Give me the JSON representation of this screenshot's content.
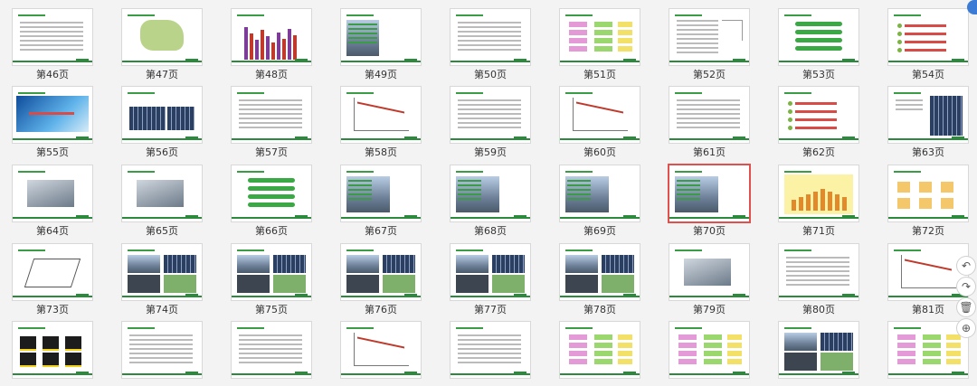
{
  "pages": [
    {
      "label": "第46页",
      "kind": "text",
      "selected": false
    },
    {
      "label": "第47页",
      "kind": "map",
      "selected": false
    },
    {
      "label": "第48页",
      "kind": "bars",
      "selected": false
    },
    {
      "label": "第49页",
      "kind": "photo-left",
      "selected": false
    },
    {
      "label": "第50页",
      "kind": "text",
      "selected": false
    },
    {
      "label": "第51页",
      "kind": "flow",
      "selected": false
    },
    {
      "label": "第52页",
      "kind": "table",
      "selected": false
    },
    {
      "label": "第53页",
      "kind": "diagram",
      "selected": false
    },
    {
      "label": "第54页",
      "kind": "list",
      "selected": false
    },
    {
      "label": "第55页",
      "kind": "banner",
      "selected": false
    },
    {
      "label": "第56页",
      "kind": "panel",
      "selected": false
    },
    {
      "label": "第57页",
      "kind": "text",
      "selected": false
    },
    {
      "label": "第58页",
      "kind": "chart",
      "selected": false
    },
    {
      "label": "第59页",
      "kind": "text",
      "selected": false
    },
    {
      "label": "第60页",
      "kind": "chart",
      "selected": false
    },
    {
      "label": "第61页",
      "kind": "text",
      "selected": false
    },
    {
      "label": "第62页",
      "kind": "list",
      "selected": false
    },
    {
      "label": "第63页",
      "kind": "panel-right",
      "selected": false
    },
    {
      "label": "第64页",
      "kind": "device",
      "selected": false
    },
    {
      "label": "第65页",
      "kind": "device",
      "selected": false
    },
    {
      "label": "第66页",
      "kind": "diagram",
      "selected": false
    },
    {
      "label": "第67页",
      "kind": "photo",
      "selected": false
    },
    {
      "label": "第68页",
      "kind": "photo",
      "selected": false
    },
    {
      "label": "第69页",
      "kind": "photo",
      "selected": false
    },
    {
      "label": "第70页",
      "kind": "photo",
      "selected": true
    },
    {
      "label": "第71页",
      "kind": "chart-yellow",
      "selected": false
    },
    {
      "label": "第72页",
      "kind": "icons",
      "selected": false
    },
    {
      "label": "第73页",
      "kind": "sketch",
      "selected": false
    },
    {
      "label": "第74页",
      "kind": "photos",
      "selected": false
    },
    {
      "label": "第75页",
      "kind": "photos",
      "selected": false
    },
    {
      "label": "第76页",
      "kind": "photos",
      "selected": false
    },
    {
      "label": "第77页",
      "kind": "photos",
      "selected": false
    },
    {
      "label": "第78页",
      "kind": "photos",
      "selected": false
    },
    {
      "label": "第79页",
      "kind": "device",
      "selected": false
    },
    {
      "label": "第80页",
      "kind": "text",
      "selected": false
    },
    {
      "label": "第81页",
      "kind": "chart",
      "selected": false
    },
    {
      "label": "",
      "kind": "icons-dark",
      "selected": false
    },
    {
      "label": "",
      "kind": "text",
      "selected": false
    },
    {
      "label": "",
      "kind": "text",
      "selected": false
    },
    {
      "label": "",
      "kind": "chart",
      "selected": false
    },
    {
      "label": "",
      "kind": "text",
      "selected": false
    },
    {
      "label": "",
      "kind": "flow",
      "selected": false
    },
    {
      "label": "",
      "kind": "flow",
      "selected": false
    },
    {
      "label": "",
      "kind": "photos",
      "selected": false
    },
    {
      "label": "",
      "kind": "flow",
      "selected": false
    }
  ],
  "tools": [
    {
      "name": "rotate-left-icon",
      "glyph": "↶"
    },
    {
      "name": "rotate-right-icon",
      "glyph": "↷"
    },
    {
      "name": "delete-icon",
      "glyph": "🗑"
    },
    {
      "name": "add-icon",
      "glyph": "⊕"
    }
  ],
  "colors": {
    "selected": "#e2504d",
    "accent": "#2c8a3c",
    "bg": "#f3f3f3"
  }
}
